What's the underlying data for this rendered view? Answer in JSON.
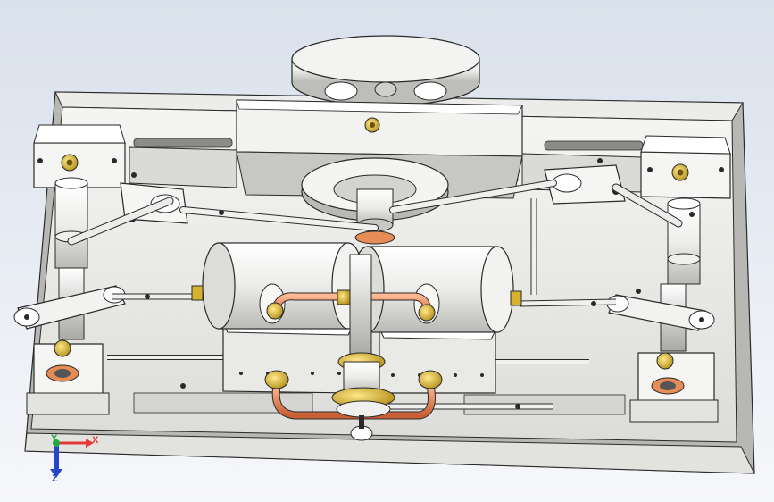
{
  "viewport": {
    "background_top": "#d9e1ec",
    "background_bottom": "#f6f7fa"
  },
  "model": {
    "components": [
      "base-plate",
      "flywheel",
      "crank-disc",
      "left-cylinder",
      "right-cylinder",
      "steam-manifold",
      "connecting-rods",
      "bearing-blocks",
      "lever-arms"
    ]
  },
  "colors": {
    "part_light": "#f2f2f0",
    "part_mid": "#c9c9c6",
    "part_dark": "#7d7d7a",
    "edge": "#2a2a2a",
    "copper": "#e9875a",
    "brass": "#d6b12e",
    "axis_x": "#e53935",
    "axis_y": "#22a844",
    "axis_z": "#2446c9"
  },
  "triad": {
    "x_label": "X",
    "y_label": "Y",
    "z_label": "Z"
  }
}
